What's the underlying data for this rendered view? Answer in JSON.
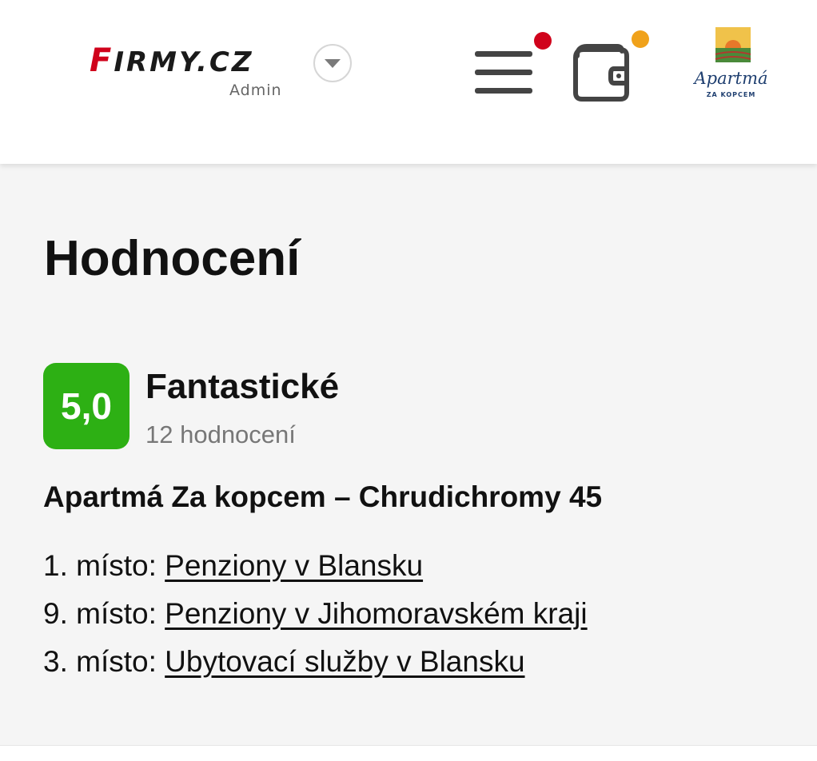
{
  "header": {
    "logo_text_first": "F",
    "logo_text_rest": "IRMY.CZ",
    "logo_sub": "Admin",
    "company_brand": "Apartmá",
    "company_brand_sub": "ZA KOPCEM",
    "menu_icon": "hamburger-icon",
    "wallet_icon": "wallet-icon",
    "switch_icon": "chevron-down-icon",
    "colors": {
      "logo_red": "#d0021b",
      "notification_red": "#d0021b",
      "notification_orange": "#f0a21b"
    }
  },
  "main": {
    "title": "Hodnocení",
    "rating": {
      "score": "5,0",
      "label": "Fantastické",
      "count": "12 hodnocení",
      "badge_color": "#2db014"
    },
    "company_name": "Apartmá Za kopcem – Chrudichromy 45",
    "rankings": [
      {
        "prefix": "1. místo: ",
        "link": "Penziony v Blansku"
      },
      {
        "prefix": "9. místo: ",
        "link": "Penziony v Jihomoravském kraji"
      },
      {
        "prefix": "3. místo: ",
        "link": "Ubytovací služby v Blansku"
      }
    ]
  }
}
